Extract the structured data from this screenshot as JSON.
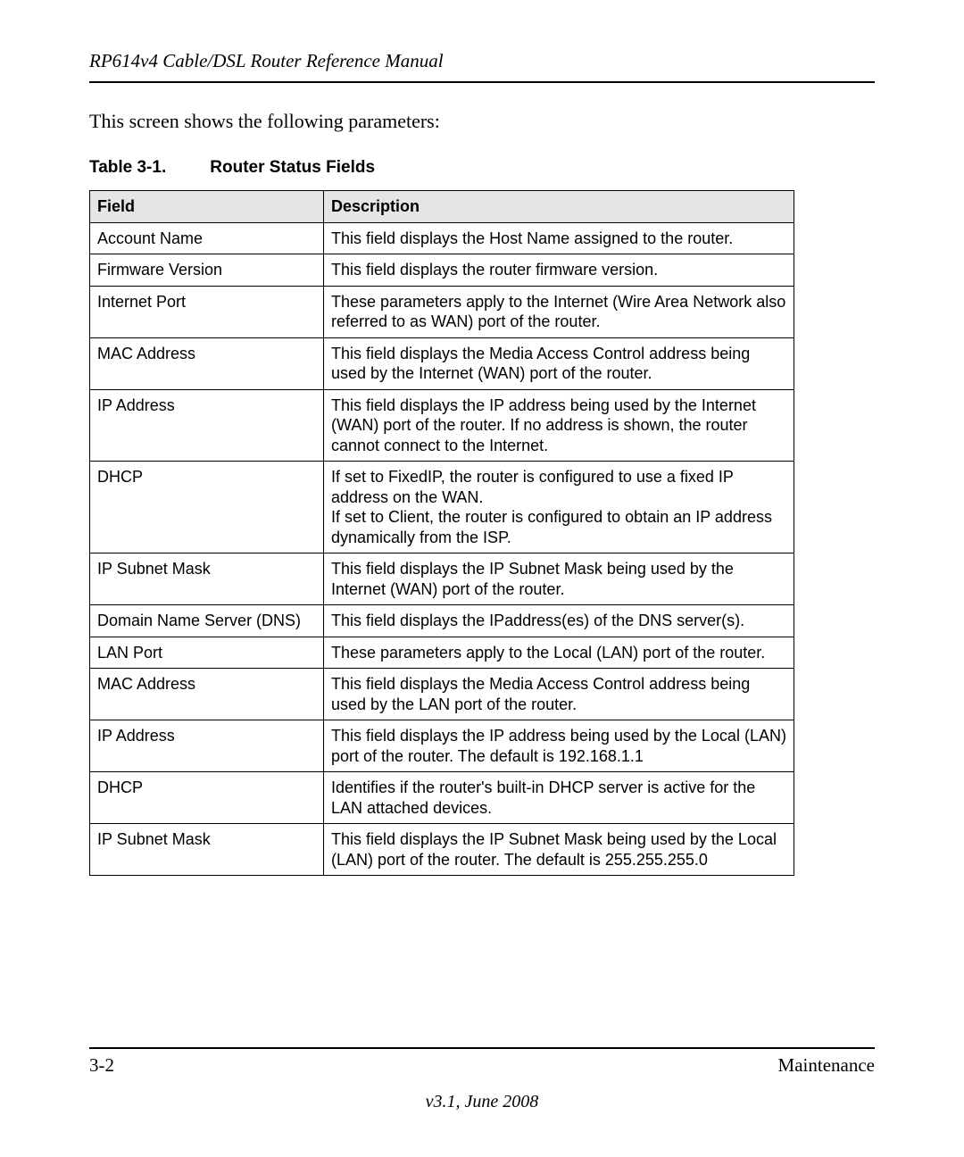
{
  "header": {
    "doc_title": "RP614v4 Cable/DSL Router Reference Manual"
  },
  "intro": "This screen shows the following parameters:",
  "table": {
    "caption_num": "Table 3-1.",
    "caption_title": "Router Status Fields",
    "head_field": "Field",
    "head_desc": "Description",
    "rows": [
      {
        "field": "Account Name",
        "indent": 0,
        "desc": "This field displays the Host Name assigned to the router."
      },
      {
        "field": "Firmware Version",
        "indent": 0,
        "desc": "This field displays the router firmware version."
      },
      {
        "field": "Internet Port",
        "indent": 0,
        "desc": "These parameters apply to the Internet (Wire Area Network also referred to as WAN) port of the router."
      },
      {
        "field": "MAC Address",
        "indent": 1,
        "desc": "This field displays the Media Access Control address being used by the Internet (WAN) port of the router."
      },
      {
        "field": "IP Address",
        "indent": 1,
        "desc": "This field displays the IP address being used by the Internet (WAN) port of the router. If no address is shown, the router cannot connect to the Internet."
      },
      {
        "field": "DHCP",
        "indent": 1,
        "desc": "If set to FixedIP, the router is configured to use a fixed IP address on the WAN.\nIf set to Client, the router is configured to obtain an IP address dynamically from the ISP."
      },
      {
        "field": "IP Subnet Mask",
        "indent": 1,
        "desc": "This field displays the IP Subnet Mask being used by the Internet (WAN) port of the router."
      },
      {
        "field": "Domain Name Server (DNS)",
        "indent": 1,
        "desc": "This field displays the IPaddress(es) of the DNS server(s)."
      },
      {
        "field": "LAN Port",
        "indent": 0,
        "desc": "These parameters apply to the Local (LAN) port of the router."
      },
      {
        "field": "MAC Address",
        "indent": 1,
        "desc": "This field displays the Media Access Control address being used by the LAN port of the router."
      },
      {
        "field": "IP Address",
        "indent": 1,
        "desc": "This field displays the IP address being used by the Local (LAN) port of the router. The default is 192.168.1.1"
      },
      {
        "field": "DHCP",
        "indent": 1,
        "desc": "Identifies if the router's built-in DHCP server is active for the LAN attached devices."
      },
      {
        "field": "IP Subnet Mask",
        "indent": 1,
        "desc": "This field displays the IP Subnet Mask being used by the Local (LAN) port of the router. The default is 255.255.255.0"
      }
    ]
  },
  "footer": {
    "page_num": "3-2",
    "section": "Maintenance",
    "version": "v3.1, June 2008"
  }
}
